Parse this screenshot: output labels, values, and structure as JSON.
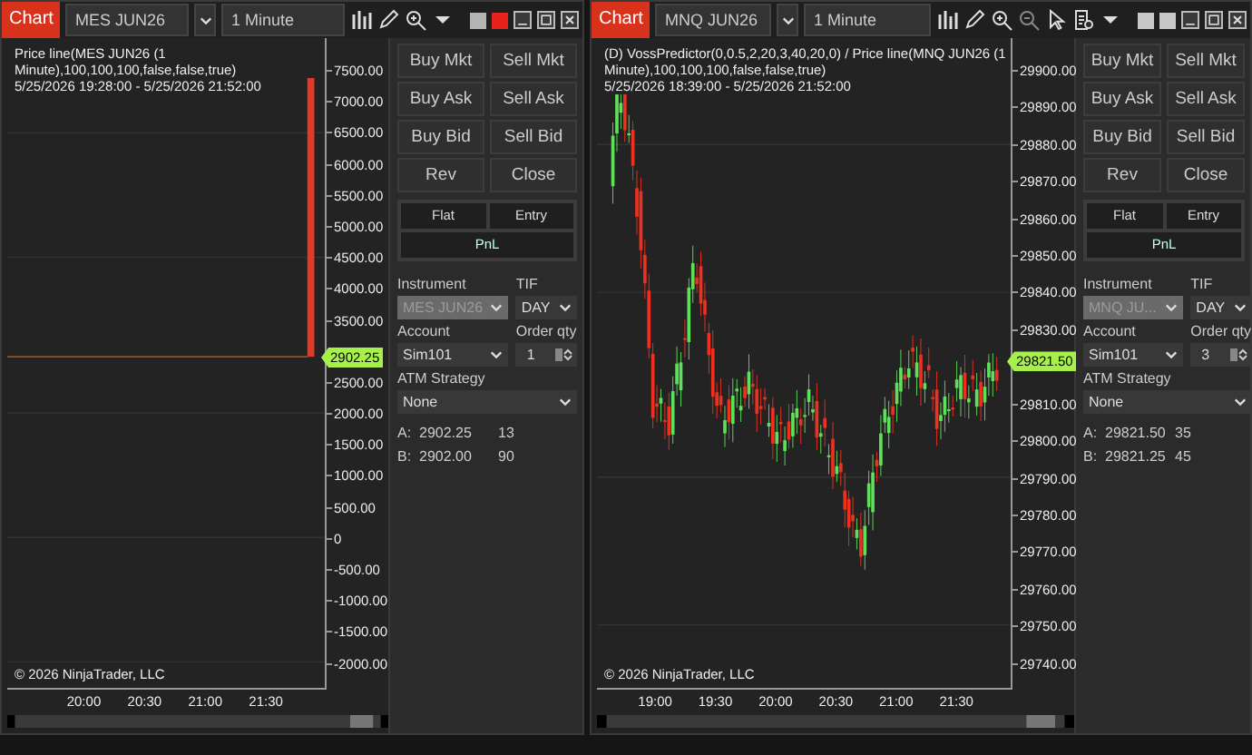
{
  "windows": [
    {
      "tab": "Chart",
      "instrument": "MES JUN26",
      "interval": "1 Minute",
      "tools": [
        {
          "kind": "bars"
        },
        {
          "kind": "pencil"
        },
        {
          "kind": "zoom_in"
        },
        {
          "kind": "dropdown"
        }
      ],
      "swatches": [
        {
          "color": "#b4b4b4"
        },
        {
          "color": "#e8231b"
        }
      ],
      "chart": {
        "kind": "price_line",
        "label": "Price line(MES JUN26 (1 Minute),100,100,100,false,false,true)",
        "range": "5/25/2026 19:28:00 - 5/25/2026 21:52:00",
        "y_ticks": [
          "7500.00",
          "7000.00",
          "6500.00",
          "6000.00",
          "5500.00",
          "5000.00",
          "4500.00",
          "4000.00",
          "3500.00",
          "2500.00",
          "2000.00",
          "1500.00",
          "1000.00",
          "500.00",
          "0",
          "-500.00",
          "-1000.00",
          "-1500.00",
          "-2000.00"
        ],
        "price_marker": "2902.25",
        "copyright": "© 2026 NinjaTrader, LLC",
        "x_ticks": [
          "20:00",
          "20:30",
          "21:00",
          "21:30"
        ]
      },
      "order": {
        "buttons": [
          "Buy Mkt",
          "Sell Mkt",
          "Buy Ask",
          "Sell Ask",
          "Buy Bid",
          "Sell Bid",
          "Rev",
          "Close"
        ],
        "flat": "Flat",
        "entry": "Entry",
        "pnl": "PnL",
        "instrument_label": "Instrument",
        "instrument": {
          "value": "MES JUN26",
          "disabled": true
        },
        "tif_label": "TIF",
        "tif": "DAY",
        "account_label": "Account",
        "account": "Sim101",
        "qty_label": "Order qty",
        "qty": "1",
        "atm_label": "ATM Strategy",
        "atm": "None",
        "quotes": [
          {
            "side": "A:",
            "price": "2902.25",
            "size": "13"
          },
          {
            "side": "B:",
            "price": "2902.00",
            "size": "90"
          }
        ]
      }
    },
    {
      "tab": "Chart",
      "instrument": "MNQ JUN26",
      "interval": "1 Minute",
      "tools": [
        {
          "kind": "bars"
        },
        {
          "kind": "pencil"
        },
        {
          "kind": "zoom_in"
        },
        {
          "kind": "zoom_out"
        },
        {
          "kind": "pointer"
        },
        {
          "kind": "properties"
        },
        {
          "kind": "dropdown"
        }
      ],
      "swatches": [
        {
          "color": "#c8c8c8"
        },
        {
          "color": "#c8c8c8"
        }
      ],
      "chart": {
        "kind": "candles",
        "label": "(D) VossPredictor(0,0.5,2,20,3,40,20,0) / Price line(MNQ JUN26 (1 Minute),100,100,100,false,false,true)",
        "range": "5/25/2026 18:39:00 - 5/25/2026 21:52:00",
        "y_ticks": [
          "29900.00",
          "29890.00",
          "29880.00",
          "29870.00",
          "29860.00",
          "29850.00",
          "29840.00",
          "29830.00",
          "29810.00",
          "29800.00",
          "29790.00",
          "29780.00",
          "29770.00",
          "29760.00",
          "29750.00",
          "29740.00"
        ],
        "price_marker": "29821.50",
        "copyright": "© 2026 NinjaTrader, LLC",
        "x_ticks": [
          "19:00",
          "19:30",
          "20:00",
          "20:30",
          "21:00",
          "21:30"
        ]
      },
      "order": {
        "buttons": [
          "Buy Mkt",
          "Sell Mkt",
          "Buy Ask",
          "Sell Ask",
          "Buy Bid",
          "Sell Bid",
          "Rev",
          "Close"
        ],
        "flat": "Flat",
        "entry": "Entry",
        "pnl": "PnL",
        "instrument_label": "Instrument",
        "instrument": {
          "value": "MNQ JU...",
          "disabled": true
        },
        "tif_label": "TIF",
        "tif": "DAY",
        "account_label": "Account",
        "account": "Sim101",
        "qty_label": "Order qty",
        "qty": "3",
        "atm_label": "ATM Strategy",
        "atm": "None",
        "quotes": [
          {
            "side": "A:",
            "price": "29821.50",
            "size": "35"
          },
          {
            "side": "B:",
            "price": "29821.25",
            "size": "45"
          }
        ]
      }
    }
  ]
}
